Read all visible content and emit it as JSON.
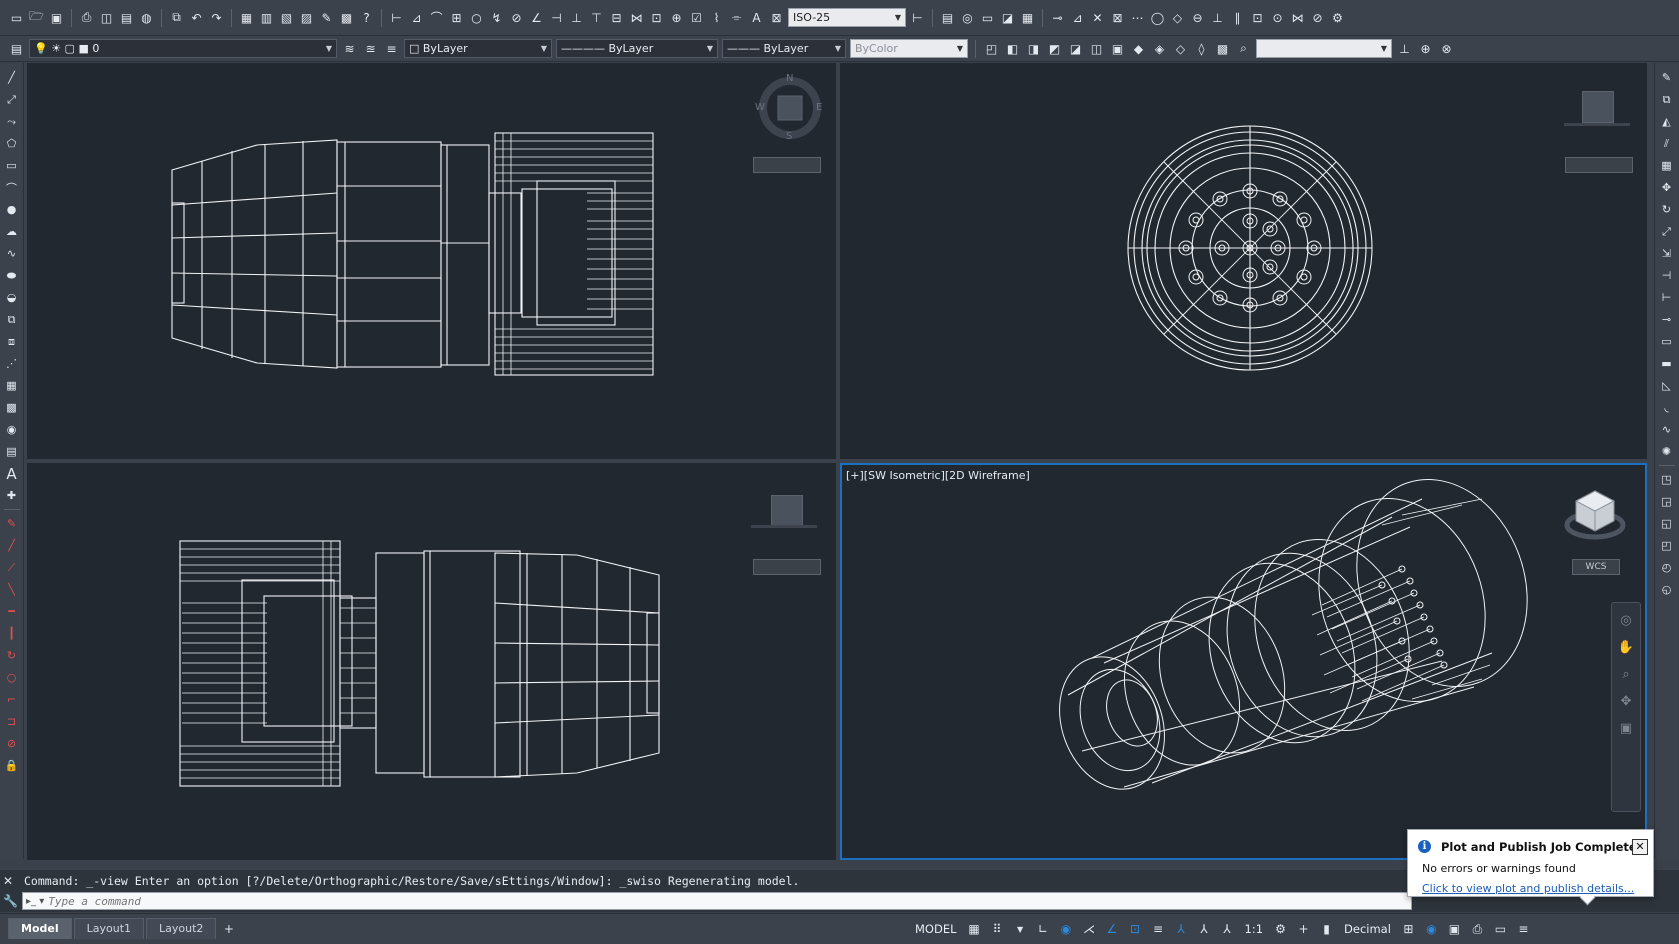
{
  "toolbar1": {
    "dimstyle_value": "ISO-25",
    "icons": [
      "new-icon",
      "open-icon",
      "save-icon",
      "plot-icon",
      "preview-icon",
      "publish-icon",
      "3d-print-icon",
      "match-props-icon",
      "undo-icon",
      "redo-icon",
      "properties-icon",
      "design-center-icon",
      "tool-palettes-icon",
      "sheet-set-icon",
      "markup-icon",
      "calculator-icon",
      "help-icon"
    ]
  },
  "toolbar2": {
    "layer_value": "0",
    "color_value": "ByLayer",
    "linetype_value": "ByLayer",
    "lineweight_value": "ByLayer",
    "plotstyle_value": "ByColor",
    "search_value": ""
  },
  "viewports": {
    "top_left": {
      "compass": {
        "n": "N",
        "s": "S",
        "e": "E",
        "w": "W"
      }
    },
    "bottom_right": {
      "label": "[+][SW Isometric][2D Wireframe]",
      "wcs": "WCS"
    }
  },
  "command": {
    "history": "Command:  _-view Enter an option [?/Delete/Orthographic/Restore/Save/sEttings/Window]:  _swiso Regenerating model.",
    "placeholder": "Type a command"
  },
  "tabs": [
    "Model",
    "Layout1",
    "Layout2"
  ],
  "status": {
    "model": "MODEL",
    "scale": "1:1",
    "units": "Decimal"
  },
  "notification": {
    "title": "Plot and Publish Job Complete",
    "message": "No errors or warnings found",
    "link": "Click to view plot and publish details..."
  },
  "colors": {
    "background": "#212830",
    "accent": "#1d6fc0",
    "wireframe": "#f2f4f7"
  }
}
